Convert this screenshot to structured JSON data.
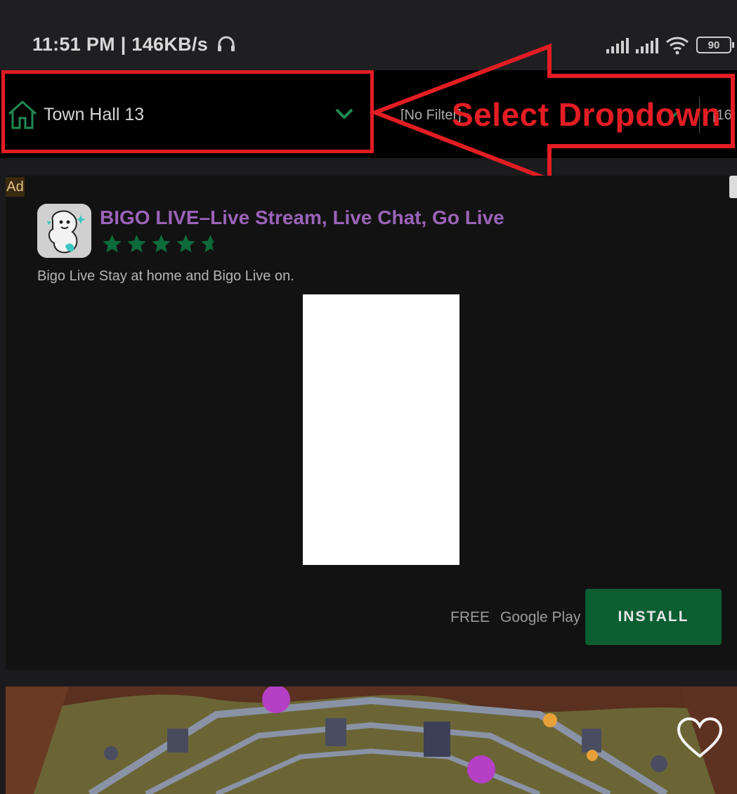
{
  "status_bar": {
    "time_speed": "11:51 PM | 146KB/s",
    "battery": "90"
  },
  "toolbar": {
    "townhall_dropdown": "Town Hall 13",
    "filter_dropdown": "[No Filter]",
    "third_dropdown_partial": "[16"
  },
  "annotation": {
    "text": "Select Dropdown",
    "color": "#e31d23"
  },
  "ad": {
    "badge": "Ad",
    "app_title": "BIGO LIVE–Live Stream, Live Chat, Go Live",
    "rating": 4.5,
    "description": "Bigo Live Stay at home and Bigo Live on.",
    "price": "FREE",
    "store": "Google Play",
    "cta": "INSTALL",
    "cta_color": "#0b5e32",
    "title_color": "#9b63b8"
  },
  "icons": {
    "home": "home-icon",
    "chevron": "chevron-down-icon",
    "heart": "heart-icon",
    "headphones": "headphones-icon",
    "wifi": "wifi-icon",
    "signal": "signal-icon",
    "battery": "battery-icon"
  }
}
